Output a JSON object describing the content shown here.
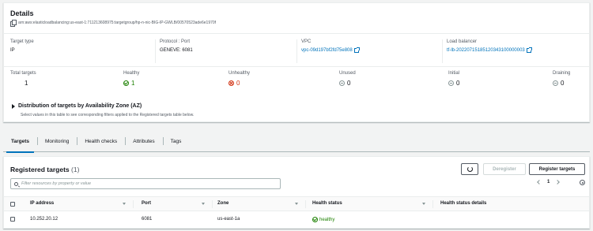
{
  "details": {
    "title": "Details",
    "arn": "arn:aws:elasticloadbalancing:us-east-1:711213608975:targetgroup/hp-n-nic-BIG-IP-GWLB/00570523ade6e1970f",
    "target_type_label": "Target type",
    "target_type_value": "IP",
    "protocol_label": "Protocol : Port",
    "protocol_value": "GENEVE: 6081",
    "vpc_label": "VPC",
    "vpc_value": "vpc-09d197bf2fd75e808",
    "lb_label": "Load balancer",
    "lb_value": "tf-lb-20220715185120343100000003"
  },
  "counts": {
    "total_label": "Total targets",
    "total_value": "1",
    "healthy_label": "Healthy",
    "healthy_value": "1",
    "unhealthy_label": "Unhealthy",
    "unhealthy_value": "0",
    "unused_label": "Unused",
    "unused_value": "0",
    "initial_label": "Initial",
    "initial_value": "0",
    "draining_label": "Draining",
    "draining_value": "0"
  },
  "distribution": {
    "title": "Distribution of targets by Availability Zone (AZ)",
    "description": "Select values in this table to see corresponding filters applied to the Registered targets table below."
  },
  "tabs": [
    {
      "label": "Targets"
    },
    {
      "label": "Monitoring"
    },
    {
      "label": "Health checks"
    },
    {
      "label": "Attributes"
    },
    {
      "label": "Tags"
    }
  ],
  "registered": {
    "title": "Registered targets",
    "count": "(1)",
    "deregister_label": "Deregister",
    "register_label": "Register targets",
    "search_placeholder": "Filter resources by property or value",
    "page": "1",
    "columns": {
      "ip": "IP address",
      "port": "Port",
      "zone": "Zone",
      "health_status": "Health status",
      "health_details": "Health status details"
    },
    "rows": [
      {
        "ip": "10.252.20.12",
        "port": "6081",
        "zone": "us-east-1a",
        "health_status": "healthy",
        "health_details": ""
      }
    ]
  },
  "colors": {
    "link": "#0073bb",
    "healthy": "#1d8102",
    "unhealthy": "#d13212",
    "neutral": "#879596"
  }
}
